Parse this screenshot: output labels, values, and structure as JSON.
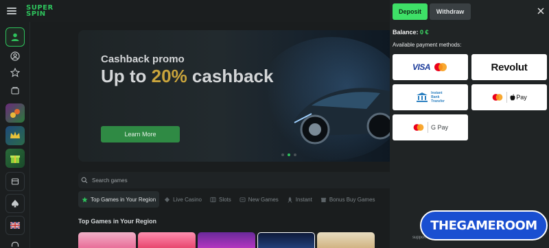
{
  "header": {
    "logo_text_line1": "SUPER",
    "logo_text_line2": "SPIN"
  },
  "rail": {
    "icons": [
      "user-icon",
      "profile-circle-icon",
      "star-icon",
      "wallet-icon",
      "promo-bonus",
      "promo-crown",
      "promo-gift",
      "cashier-icon",
      "spade-icon",
      "uk-flag-icon",
      "headset-icon"
    ]
  },
  "banner": {
    "subtitle": "Cashback promo",
    "title_prefix": "Up to ",
    "title_accent": "20%",
    "title_suffix": " cashback",
    "cta_label": "Learn More",
    "slide_count": 3,
    "active_slide": 2
  },
  "search": {
    "placeholder": "Search games"
  },
  "categories": [
    {
      "label": "Top Games in Your Region",
      "icon": "star-icon",
      "active": true
    },
    {
      "label": "Live Casino",
      "icon": "diamond-icon",
      "active": false
    },
    {
      "label": "Slots",
      "icon": "slots-icon",
      "active": false
    },
    {
      "label": "New Games",
      "icon": "new-icon",
      "active": false
    },
    {
      "label": "Instant",
      "icon": "rocket-icon",
      "active": false
    },
    {
      "label": "Bonus Buy Games",
      "icon": "bonus-icon",
      "active": false
    }
  ],
  "section": {
    "title": "Top Games in Your Region"
  },
  "cashier": {
    "deposit_label": "Deposit",
    "withdraw_label": "Withdraw",
    "balance_label": "Balance:",
    "balance_value": "0 €",
    "methods_label": "Available payment methods:",
    "methods": {
      "visa_mc": "VISA",
      "revolut": "Revolut",
      "instant_bank_1": "Instant",
      "instant_bank_2": "Bank",
      "instant_bank_3": "Transfer",
      "apple_pay": "Pay",
      "google_pay": "G Pay"
    },
    "support_text": "support"
  },
  "watermark": {
    "text": "THEGAMEROOM"
  },
  "colors": {
    "accent_green": "#3ee067",
    "gold": "#c9a43c",
    "watermark_blue": "#1a4fd1"
  }
}
